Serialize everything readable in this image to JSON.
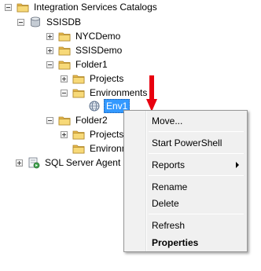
{
  "tree": {
    "root": "Integration Services Catalogs",
    "ssisdb": "SSISDB",
    "nyc": "NYCDemo",
    "ssisdemo": "SSISDemo",
    "folder1": "Folder1",
    "projects1": "Projects",
    "environments1": "Environments",
    "env1": "Env1",
    "folder2": "Folder2",
    "projects2": "Projects",
    "environments2": "Environments",
    "agent": "SQL Server Agent"
  },
  "context_menu": {
    "move": "Move...",
    "powershell": "Start PowerShell",
    "reports": "Reports",
    "rename": "Rename",
    "delete": "Delete",
    "refresh": "Refresh",
    "properties": "Properties"
  },
  "colors": {
    "selection": "#3399ff",
    "annotation_arrow": "#e8000f",
    "folder": "#f2c94c"
  }
}
